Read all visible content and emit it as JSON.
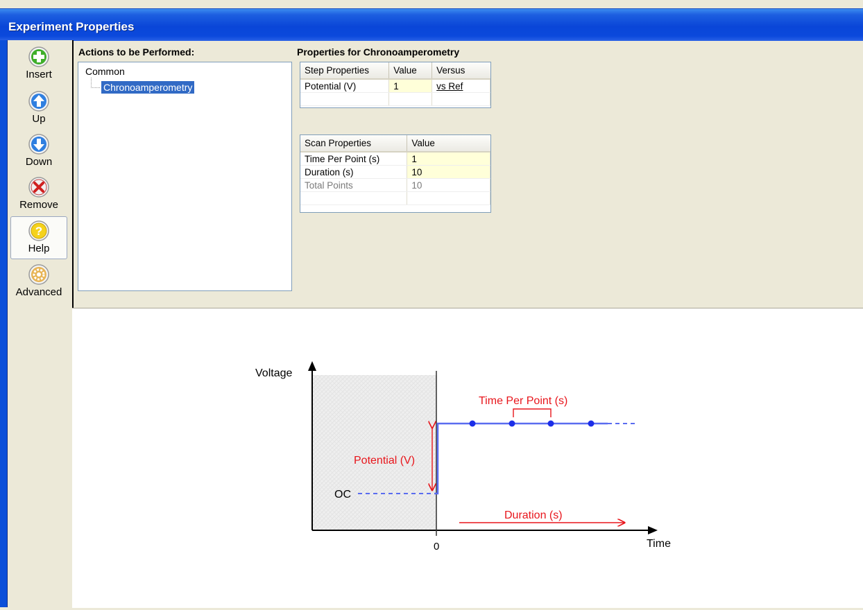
{
  "window": {
    "title": "Experiment Properties"
  },
  "toolbar": {
    "items": [
      {
        "label": "Insert",
        "icon": "plus-icon"
      },
      {
        "label": "Up",
        "icon": "arrow-up-icon"
      },
      {
        "label": "Down",
        "icon": "arrow-down-icon"
      },
      {
        "label": "Remove",
        "icon": "remove-x-icon"
      },
      {
        "label": "Help",
        "icon": "help-icon"
      },
      {
        "label": "Advanced",
        "icon": "advanced-gear-icon"
      }
    ]
  },
  "actions": {
    "title": "Actions to be Performed:",
    "tree": {
      "root": "Common",
      "child": "Chronoamperometry"
    }
  },
  "properties": {
    "title": "Properties for Chronoamperometry",
    "step": {
      "headers": [
        "Step Properties",
        "Value",
        "Versus"
      ],
      "rows": [
        {
          "name": "Potential (V)",
          "value": "1",
          "versus": "vs Ref"
        }
      ]
    },
    "scan": {
      "headers": [
        "Scan Properties",
        "Value"
      ],
      "rows": [
        {
          "name": "Time Per Point (s)",
          "value": "1"
        },
        {
          "name": "Duration (s)",
          "value": "10"
        },
        {
          "name": "Total Points",
          "value": "10"
        }
      ]
    }
  },
  "diagram": {
    "y_axis_label": "Voltage",
    "x_axis_label": "Time",
    "origin_label": "0",
    "oc_label": "OC",
    "potential_label": "Potential (V)",
    "time_per_point_label": "Time Per Point (s)",
    "duration_label": "Duration (s)",
    "colors": {
      "annotation": "#e8151b",
      "signal": "#5a6cf0",
      "point": "#1c2ee8"
    }
  }
}
